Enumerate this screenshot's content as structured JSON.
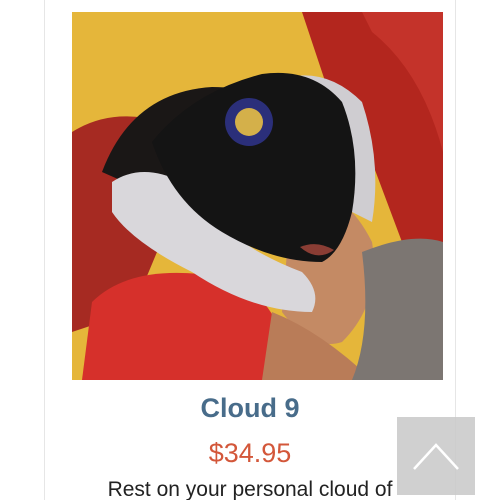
{
  "product": {
    "title": "Cloud 9",
    "price": "$34.95",
    "description": "Rest on your personal cloud of"
  },
  "scroll_top": {
    "icon": "chevron-up-icon"
  },
  "colors": {
    "title": "#486c8a",
    "price": "#d3573a",
    "scroll_button": "#c8c8c8"
  }
}
